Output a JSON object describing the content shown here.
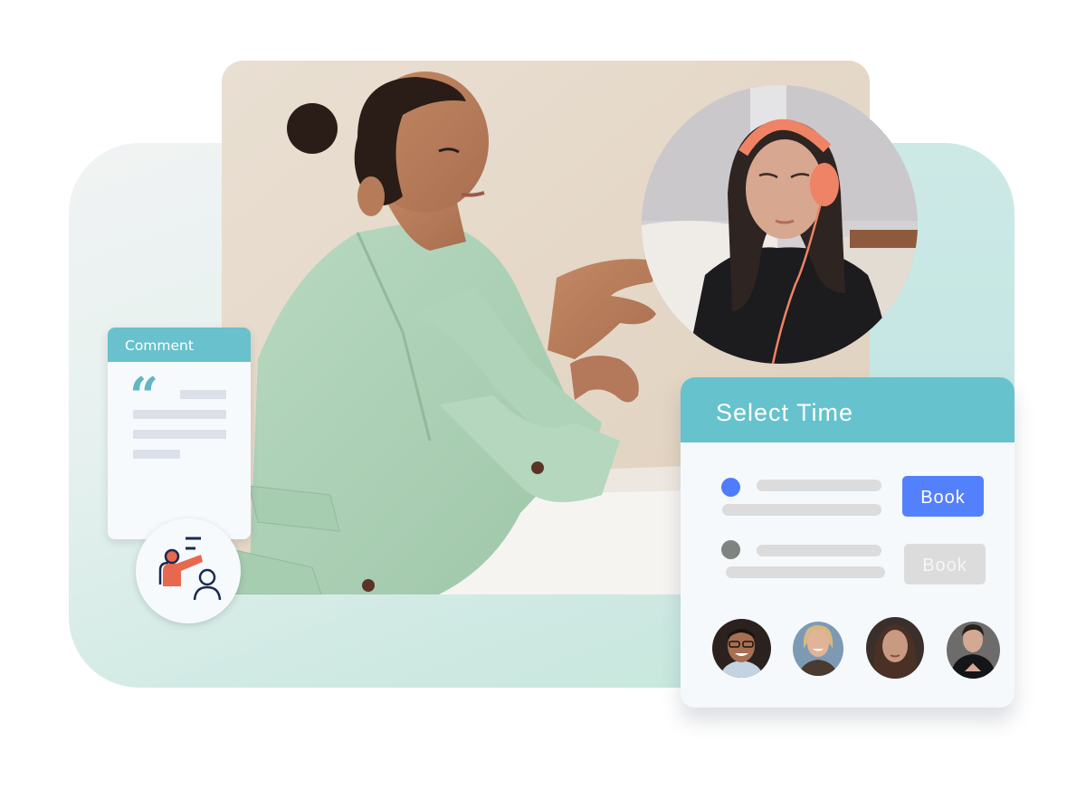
{
  "comment_card": {
    "title": "Comment",
    "quote_icon": "quote-icon",
    "quote_glyph": "“",
    "placeholder_lines": 4
  },
  "teacher_badge": {
    "icon": "teacher-student-icon"
  },
  "main_photo": {
    "description": "Woman in mint green blazer gesturing while speaking"
  },
  "circle_photo": {
    "description": "Young woman wearing orange headphones"
  },
  "select_time_card": {
    "title": "Select Time",
    "slots": [
      {
        "status": "available",
        "dot_color": "#4f7cfb",
        "button_label": "Book",
        "button_color": "#5380fc",
        "enabled": true
      },
      {
        "status": "unavailable",
        "dot_color": "#7f8480",
        "button_label": "Book",
        "button_color": "#dcdcdc",
        "enabled": false
      }
    ],
    "avatars": [
      {
        "name": "avatar-man-glasses"
      },
      {
        "name": "avatar-woman-blonde"
      },
      {
        "name": "avatar-woman-brunette"
      },
      {
        "name": "avatar-man-dark-hair"
      }
    ]
  },
  "colors": {
    "teal_header": "#66c2cc",
    "accent_blue": "#5380fc",
    "disabled_gray": "#dcdcdc",
    "icon_coral": "#e8684f",
    "icon_navy": "#1b2a4e",
    "mint_bg": "#c2e6d8"
  }
}
